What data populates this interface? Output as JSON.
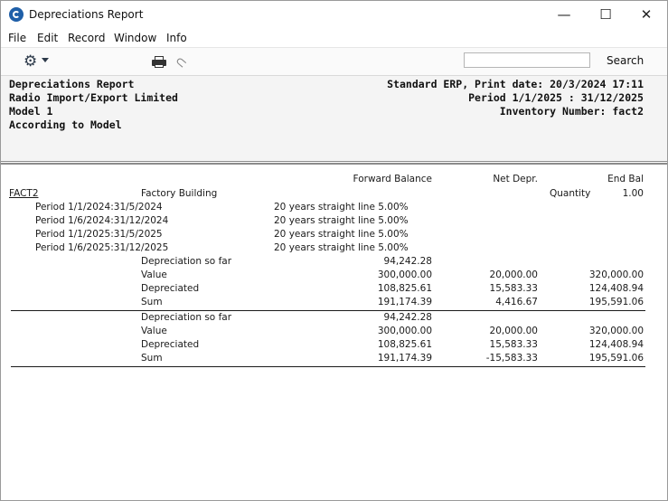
{
  "window": {
    "title": "Depreciations Report",
    "minimize_glyph": "—",
    "maximize_glyph": "☐",
    "close_glyph": "✕"
  },
  "menu": [
    "File",
    "Edit",
    "Record",
    "Window",
    "Info"
  ],
  "toolbar": {
    "search_placeholder": "",
    "search_label": "Search",
    "icons": [
      "gear-icon",
      "printer-icon",
      "paperclip-icon"
    ]
  },
  "report_header": {
    "left": [
      "Depreciations Report",
      "Radio Import/Export Limited",
      "Model 1",
      "According to Model"
    ],
    "right": [
      "Standard ERP, Print date: 20/3/2024 17:11",
      "Period  1/1/2025 : 31/12/2025",
      "Inventory Number: fact2"
    ]
  },
  "columns": {
    "forward_balance": "Forward Balance",
    "net_depr": "Net Depr.",
    "end_bal": "End Bal"
  },
  "asset": {
    "code": "FACT2",
    "name": "Factory Building",
    "quantity_label": "Quantity",
    "quantity": "1.00",
    "periods": [
      {
        "period": "Period 1/1/2024:31/5/2024",
        "method": "20 years straight line 5.00%"
      },
      {
        "period": "Period 1/6/2024:31/12/2024",
        "method": "20 years straight line 5.00%"
      },
      {
        "period": "Period 1/1/2025:31/5/2025",
        "method": "20 years straight line 5.00%"
      },
      {
        "period": "Period 1/6/2025:31/12/2025",
        "method": "20 years straight line 5.00%"
      }
    ]
  },
  "block1": {
    "rows": [
      {
        "label": "Depreciation so far",
        "fwd": "94,242.28",
        "net": "",
        "end": ""
      },
      {
        "label": "Value",
        "fwd": "300,000.00",
        "net": "20,000.00",
        "end": "320,000.00"
      },
      {
        "label": "Depreciated",
        "fwd": "108,825.61",
        "net": "15,583.33",
        "end": "124,408.94"
      },
      {
        "label": "Sum",
        "fwd": "191,174.39",
        "net": "4,416.67",
        "end": "195,591.06"
      }
    ]
  },
  "block2": {
    "rows": [
      {
        "label": "Depreciation so far",
        "fwd": "94,242.28",
        "net": "",
        "end": ""
      },
      {
        "label": "Value",
        "fwd": "300,000.00",
        "net": "20,000.00",
        "end": "320,000.00"
      },
      {
        "label": "Depreciated",
        "fwd": "108,825.61",
        "net": "15,583.33",
        "end": "124,408.94"
      },
      {
        "label": "Sum",
        "fwd": "191,174.39",
        "net": "-15,583.33",
        "end": "195,591.06"
      }
    ]
  }
}
